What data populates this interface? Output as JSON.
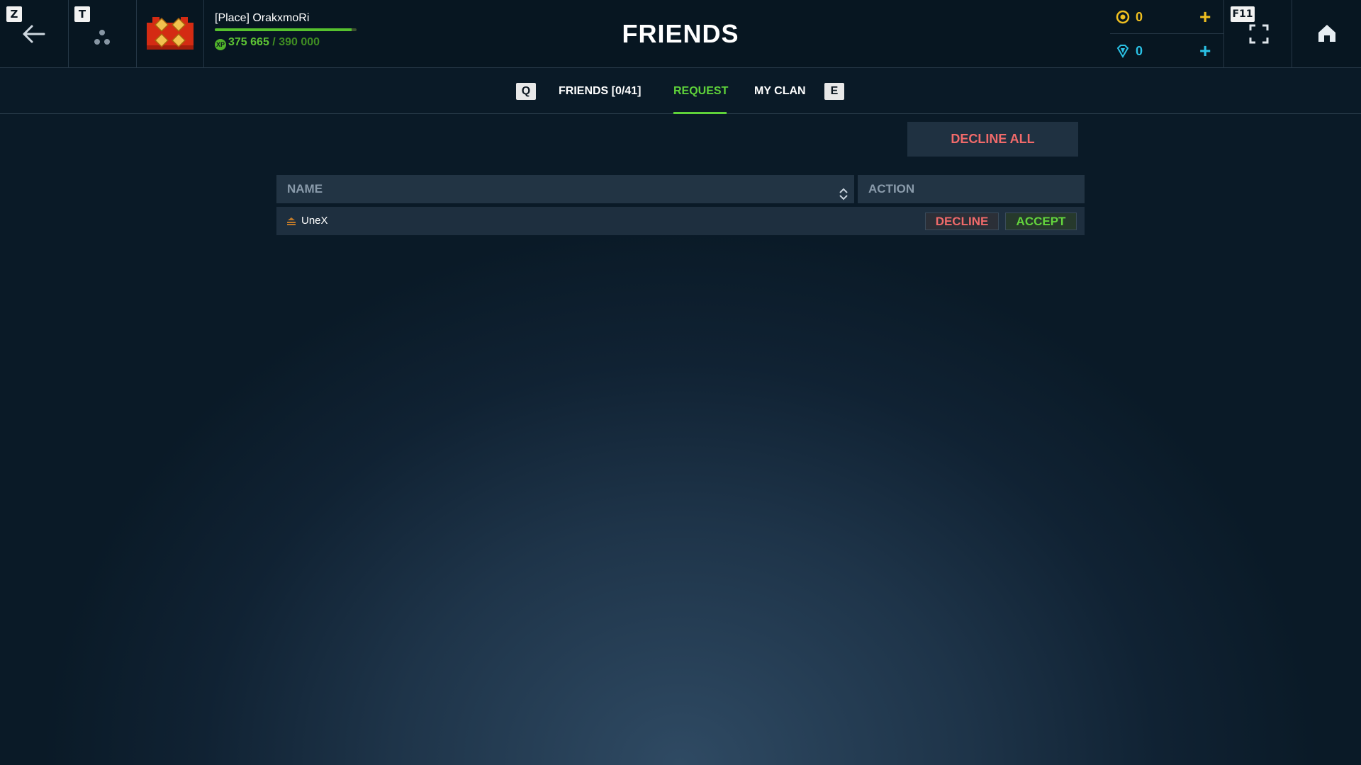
{
  "header": {
    "back_key": "Z",
    "party_key": "T",
    "fullscreen_key": "F11",
    "title": "FRIENDS",
    "player": {
      "name": "[Place] OrakxmoRi",
      "xp_current": "375 665",
      "xp_separator": "/",
      "xp_max": "390 000",
      "xp_progress": 0.963
    },
    "currency": {
      "gold": "0",
      "gems": "0",
      "add_symbol": "+"
    }
  },
  "tabs": {
    "prev_key": "Q",
    "next_key": "E",
    "items": [
      {
        "label": "FRIENDS [0/41]",
        "active": false
      },
      {
        "label": "REQUEST",
        "active": true
      },
      {
        "label": "MY CLAN",
        "active": false
      }
    ]
  },
  "requests": {
    "decline_all_label": "DECLINE ALL",
    "columns": {
      "name": "NAME",
      "action": "ACTION"
    },
    "rows": [
      {
        "name": "UneX",
        "decline_label": "DECLINE",
        "accept_label": "ACCEPT"
      }
    ]
  },
  "colors": {
    "accent_green": "#5fd23a",
    "decline_red": "#f06a6a",
    "gold": "#f0c020",
    "gem_blue": "#2ac2e6",
    "topbar_bg": "#071621"
  },
  "icons": {
    "back": "arrow-left-icon",
    "party": "party-dots-icon",
    "rank": "rank-emblem-icon",
    "xp": "xp-icon",
    "gold": "gold-coin-icon",
    "gems": "gem-icon",
    "fullscreen": "fullscreen-icon",
    "home": "home-icon",
    "sort": "sort-icon",
    "row_rank": "rank-chevron-icon"
  }
}
